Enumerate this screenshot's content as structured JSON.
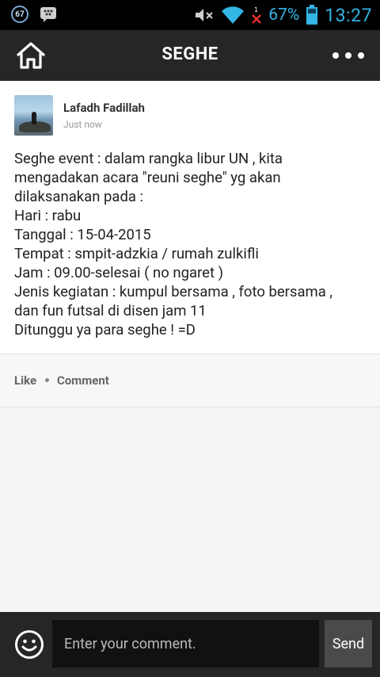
{
  "status_bar": {
    "notif_badge": "67",
    "battery_percent": "67%",
    "time": "13:27",
    "icons": [
      "notification-badge-icon",
      "bbm-icon",
      "mute-icon",
      "wifi-icon",
      "no-signal-icon",
      "battery-icon"
    ]
  },
  "header": {
    "title": "SEGHE",
    "home_icon": "home-icon",
    "more_icon": "more-dots-icon"
  },
  "post": {
    "author": "Lafadh Fadillah",
    "time": "Just now",
    "lines": [
      "Seghe event : dalam rangka libur UN , kita",
      "mengadakan acara \"reuni seghe\" yg akan",
      "dilaksanakan pada :",
      "Hari : rabu",
      "Tanggal : 15-04-2015",
      "Tempat : smpit-adzkia / rumah zulkifli",
      "Jam : 09.00-selesai ( no ngaret )",
      "Jenis kegiatan : kumpul bersama , foto bersama ,",
      "dan fun futsal di disen jam 11",
      "Ditunggu ya para seghe ! =D"
    ]
  },
  "actions": {
    "like": "Like",
    "comment": "Comment"
  },
  "comment_bar": {
    "placeholder": "Enter your comment.",
    "send": "Send",
    "emoji_icon": "smiley-icon"
  },
  "colors": {
    "status_accent": "#33b5e5",
    "header_bg": "#262626",
    "status_bg": "#000000"
  }
}
